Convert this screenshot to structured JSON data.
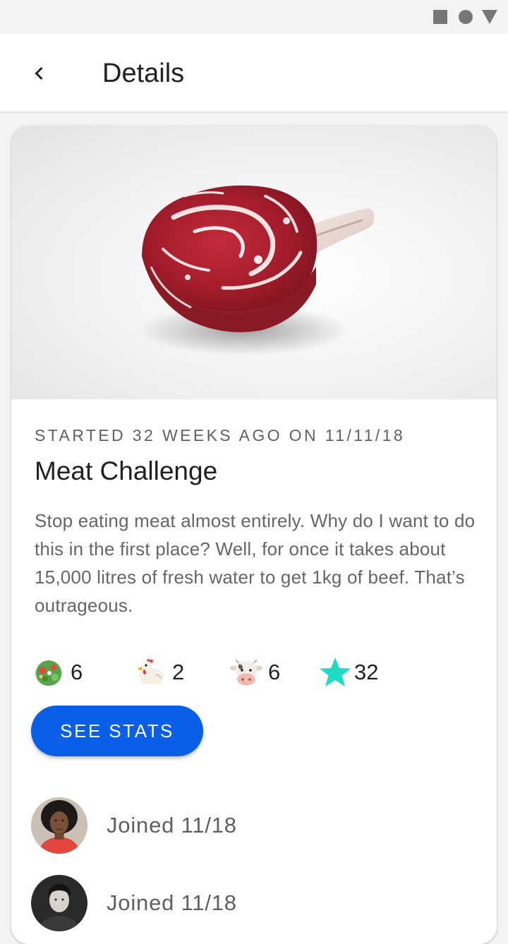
{
  "status_bar": {
    "icons": [
      "square-icon",
      "circle-icon",
      "triangle-icon"
    ]
  },
  "app_bar": {
    "back_icon": "chevron-left-icon",
    "title": "Details"
  },
  "challenge": {
    "image": "raw-ribeye-steak-photo",
    "started_text": "STARTED 32 WEEKS AGO ON 11/11/18",
    "title": "Meat Challenge",
    "description": "Stop eating meat almost entirely. Why do I want to do this in the first place? Well, for once it takes about 15,000 litres of fresh water to get 1kg of beef. That’s outrageous.",
    "stats": [
      {
        "icon": "salad-icon",
        "count": "6"
      },
      {
        "icon": "chicken-icon",
        "count": "2"
      },
      {
        "icon": "cow-icon",
        "count": "6"
      },
      {
        "icon": "star-icon",
        "count": "32"
      }
    ],
    "see_stats_label": "SEE STATS"
  },
  "members": [
    {
      "avatar": "avatar-woman",
      "joined": "Joined 11/18"
    },
    {
      "avatar": "avatar-man",
      "joined": "Joined 11/18"
    }
  ],
  "colors": {
    "accent": "#0a5fe8",
    "star": "#1ddcc3",
    "background": "#f3f3f3",
    "card": "#ffffff"
  }
}
